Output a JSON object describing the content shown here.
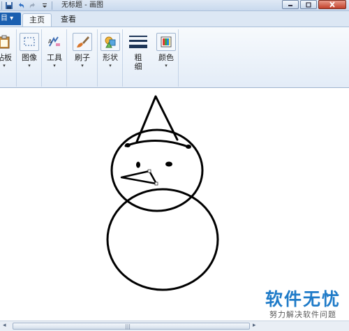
{
  "window": {
    "title": "无标题 - 画图",
    "quick_access": [
      "save-icon",
      "undo-icon",
      "redo-icon",
      "customize-qat-icon"
    ]
  },
  "ribbon_tabs": {
    "file_label": "目 ▾",
    "home_label": "主页",
    "view_label": "查看"
  },
  "ribbon_groups": [
    {
      "label": "贴板",
      "icon": "clipboard-icon"
    },
    {
      "label": "图像",
      "icon": "image-select-icon"
    },
    {
      "label": "工具",
      "icon": "tools-icon"
    },
    {
      "label": "刷子",
      "icon": "brush-icon"
    },
    {
      "label": "形状",
      "icon": "shapes-icon"
    },
    {
      "label": "粗\n细",
      "icon": "line-width-icon"
    },
    {
      "label": "颜色",
      "icon": "colors-icon"
    }
  ],
  "colors": {
    "file_tab": "#1a5fb0",
    "canvas": "#ffffff",
    "stroke": "#000000"
  },
  "watermark": {
    "brand": "软件无忧",
    "tagline": "努力解决软件问题"
  }
}
